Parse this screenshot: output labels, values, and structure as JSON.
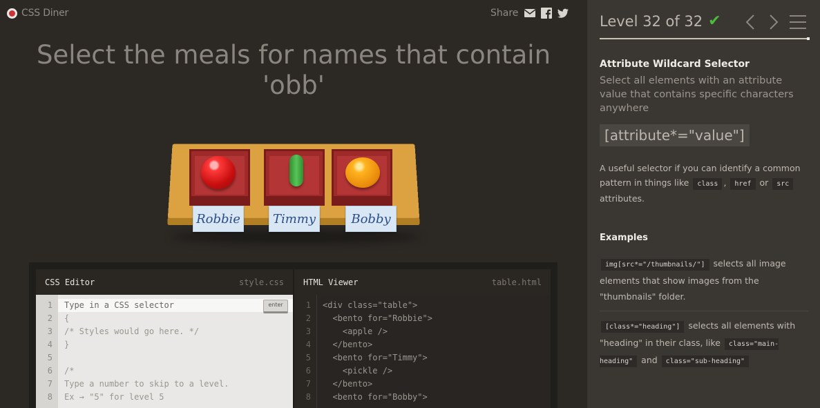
{
  "app": {
    "title": "CSS Diner"
  },
  "share": {
    "label": "Share",
    "icons": [
      "email-icon",
      "facebook-icon",
      "twitter-icon"
    ]
  },
  "instruction": "Select the meals for names that contain 'obb'",
  "table": {
    "bentos": [
      {
        "name": "Robbie",
        "food": "apple"
      },
      {
        "name": "Timmy",
        "food": "pickle"
      },
      {
        "name": "Bobby",
        "food": "orange"
      }
    ]
  },
  "editor": {
    "css": {
      "title": "CSS Editor",
      "file": "style.css",
      "enter_label": "enter",
      "lines": [
        {
          "n": "1",
          "text": "Type in a CSS selector"
        },
        {
          "n": "2",
          "text": "{"
        },
        {
          "n": "3",
          "text": "/* Styles would go here. */"
        },
        {
          "n": "4",
          "text": "}"
        },
        {
          "n": "5",
          "text": ""
        },
        {
          "n": "6",
          "text": "/*"
        },
        {
          "n": "7",
          "text": "Type a number to skip to a level."
        },
        {
          "n": "8",
          "text": "Ex → \"5\" for level 5"
        }
      ]
    },
    "html": {
      "title": "HTML Viewer",
      "file": "table.html",
      "lines": [
        {
          "n": "1",
          "text": "<div class=\"table\">"
        },
        {
          "n": "2",
          "text": "  <bento for=\"Robbie\">"
        },
        {
          "n": "3",
          "text": "    <apple />"
        },
        {
          "n": "4",
          "text": "  </bento>"
        },
        {
          "n": "5",
          "text": "  <bento for=\"Timmy\">"
        },
        {
          "n": "6",
          "text": "    <pickle />"
        },
        {
          "n": "7",
          "text": "  </bento>"
        },
        {
          "n": "8",
          "text": "  <bento for=\"Bobby\">"
        }
      ]
    }
  },
  "sidebar": {
    "level_text": "Level 32 of 32",
    "current_level": 32,
    "total_levels": 32,
    "completed": true,
    "selector_name": "Attribute Wildcard Selector",
    "selector_desc": "Select all elements with an attribute value that contains specific characters anywhere",
    "syntax": "[attribute*=\"value\"]",
    "hint": {
      "before": "A useful selector if you can identify a common pattern in things like",
      "chip1": "class",
      "sep1": ",",
      "chip2": "href",
      "sep2": "or",
      "chip3": "src",
      "after": "attributes."
    },
    "examples_title": "Examples",
    "examples": [
      {
        "code": "img[src*=\"/thumbnails/\"]",
        "text": "selects all image elements that show images from the \"thumbnails\" folder."
      },
      {
        "code": "[class*=\"heading\"]",
        "text": "selects all elements with \"heading\" in their class, like",
        "code2": "class=\"main-heading\"",
        "and": "and",
        "code3": "class=\"sub-heading\""
      }
    ]
  },
  "colors": {
    "background": "#2c2925",
    "sidebar": "#3a3632",
    "check": "#4cbb3c",
    "name_tag_text": "#2b4f86"
  }
}
